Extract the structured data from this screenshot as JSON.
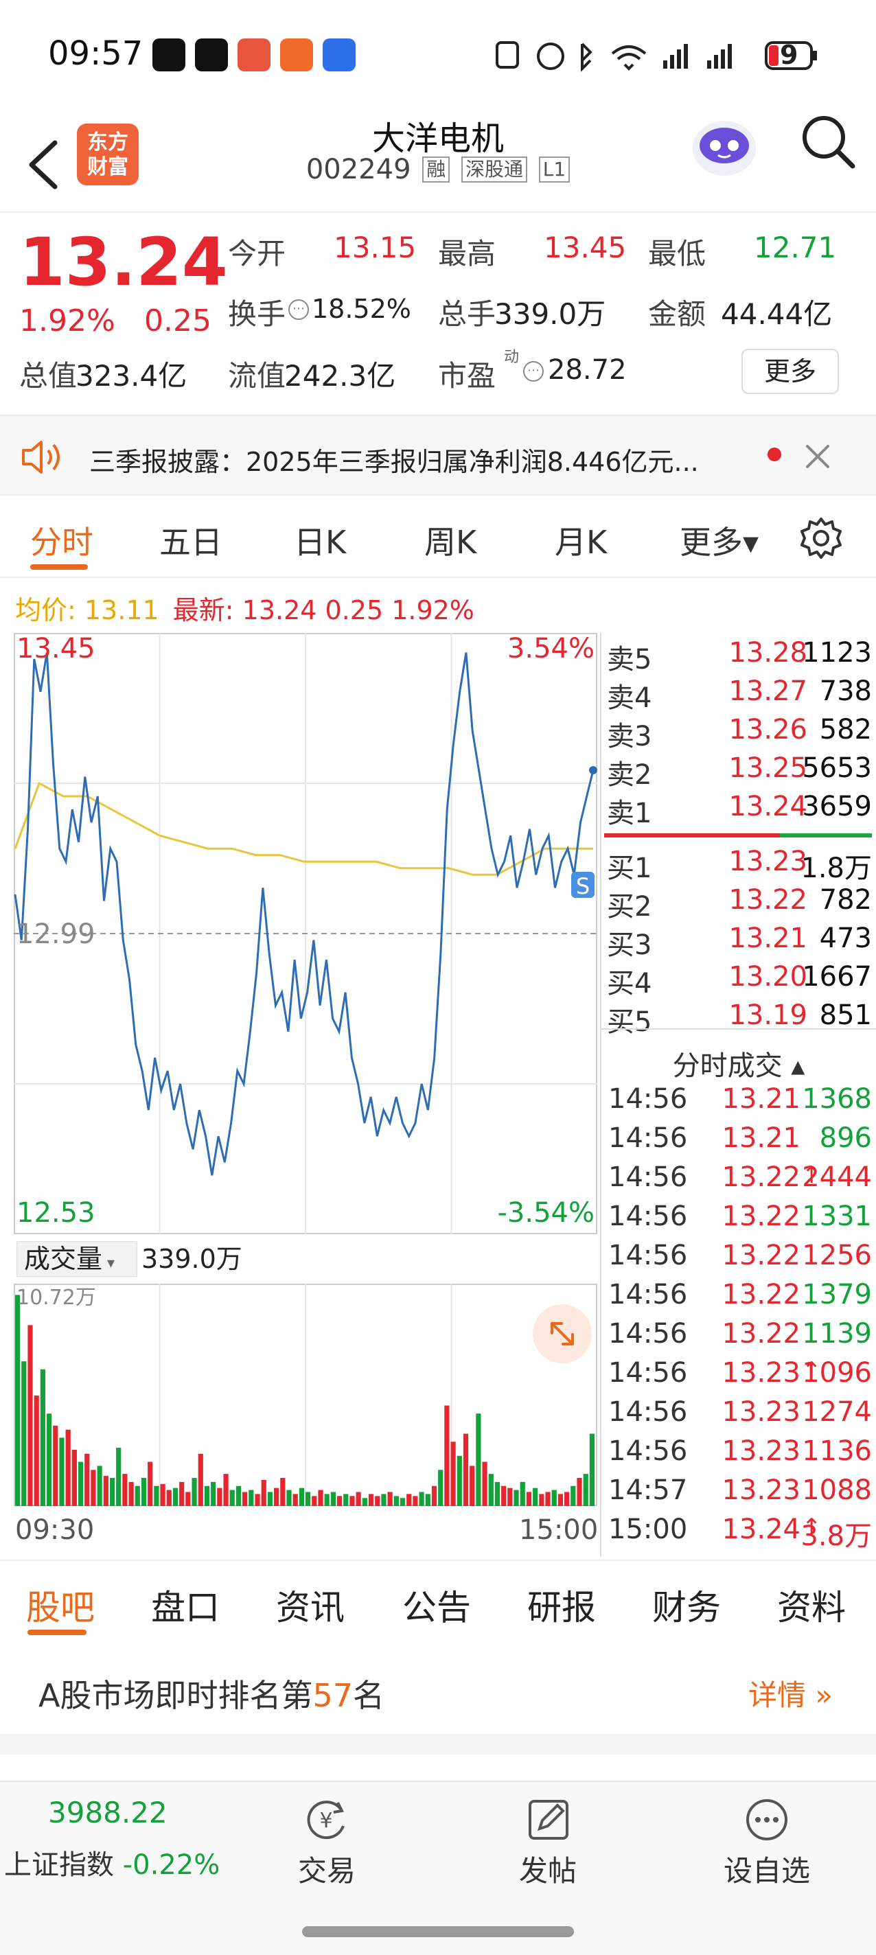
{
  "status": {
    "time": "09:57",
    "battery": "9"
  },
  "header": {
    "stock_name": "大洋电机",
    "stock_code": "002249",
    "tags": [
      "融",
      "深股通",
      "L1"
    ],
    "logo_line1": "东方",
    "logo_line2": "财富"
  },
  "quote": {
    "price": "13.24",
    "change_pct": "1.92%",
    "change_val": "0.25",
    "open_label": "今开",
    "open": "13.15",
    "high_label": "最高",
    "high": "13.45",
    "low_label": "最低",
    "low": "12.71",
    "turnover_label": "换手",
    "turnover": "18.52%",
    "vol_label": "总手",
    "vol": "339.0万",
    "amount_label": "金额",
    "amount": "44.44亿",
    "mktcap_label": "总值",
    "mktcap": "323.4亿",
    "float_label": "流值",
    "float": "242.3亿",
    "pe_label": "市盈",
    "pe_sup": "动",
    "pe": "28.72",
    "more": "更多"
  },
  "notice": {
    "text": "三季报披露：2025年三季报归属净利润8.446亿元..."
  },
  "chart_tabs": [
    "分时",
    "五日",
    "日K",
    "周K",
    "月K",
    "更多▾"
  ],
  "info_line": {
    "avg_label": "均价: 13.11",
    "latest_label": "最新: 13.24 0.25 1.92%"
  },
  "chart_labels": {
    "top_price": "13.45",
    "top_pct": "3.54%",
    "mid_price": "12.99",
    "bottom_price": "12.53",
    "bottom_pct": "-3.54%",
    "volume_label": "成交量",
    "volume_total": "339.0万",
    "volume_max": "10.72万",
    "time_start": "09:30",
    "time_end": "15:00",
    "marker": "S"
  },
  "chart_data": {
    "type": "line",
    "ylim": [
      12.53,
      13.45
    ],
    "ref_price": 12.99,
    "series": [
      {
        "values": [
          13.05,
          12.98,
          13.15,
          13.41,
          13.36,
          13.42,
          13.25,
          13.12,
          13.1,
          13.18,
          13.13,
          13.23,
          13.16,
          13.2,
          13.04,
          13.12,
          13.1,
          12.98,
          12.92,
          12.82,
          12.78,
          12.72,
          12.8,
          12.75,
          12.78,
          12.72,
          12.76,
          12.7,
          12.66,
          12.72,
          12.68,
          12.62,
          12.68,
          12.64,
          12.7,
          12.78,
          12.76,
          12.84,
          12.93,
          13.06,
          12.96,
          12.88,
          12.9,
          12.84,
          12.95,
          12.86,
          12.9,
          12.98,
          12.88,
          12.95,
          12.86,
          12.84,
          12.9,
          12.8,
          12.76,
          12.7,
          12.74,
          12.68,
          12.72,
          12.7,
          12.74,
          12.7,
          12.68,
          12.7,
          12.76,
          12.72,
          12.8,
          12.96,
          13.18,
          13.28,
          13.36,
          13.42,
          13.3,
          13.24,
          13.18,
          13.12,
          13.08,
          13.1,
          13.14,
          13.06,
          13.1,
          13.15,
          13.08,
          13.12,
          13.14,
          13.06,
          13.1,
          13.12,
          13.08,
          13.16,
          13.2,
          13.24
        ]
      },
      {
        "values": [
          13.12,
          13.22,
          13.2,
          13.2,
          13.18,
          13.16,
          13.14,
          13.13,
          13.12,
          13.12,
          13.11,
          13.11,
          13.1,
          13.1,
          13.1,
          13.1,
          13.09,
          13.09,
          13.09,
          13.08,
          13.08,
          13.1,
          13.12,
          13.12,
          13.12
        ]
      }
    ]
  },
  "volume_data": {
    "max": 10.72,
    "bars": [
      10.5,
      7.2,
      9.0,
      5.5,
      6.8,
      4.6,
      4.0,
      3.4,
      3.8,
      2.8,
      2.2,
      2.6,
      1.8,
      2.0,
      1.5,
      1.4,
      2.9,
      1.6,
      1.2,
      1.0,
      1.4,
      2.2,
      1.0,
      1.1,
      0.8,
      0.9,
      1.2,
      0.7,
      1.4,
      2.6,
      1.0,
      1.2,
      0.9,
      1.6,
      0.8,
      1.0,
      0.7,
      0.8,
      0.6,
      1.3,
      0.7,
      0.9,
      1.4,
      0.8,
      0.6,
      0.9,
      0.7,
      0.5,
      0.8,
      0.6,
      0.7,
      0.5,
      0.6,
      0.5,
      0.7,
      0.4,
      0.6,
      0.5,
      0.6,
      0.7,
      0.5,
      0.4,
      0.6,
      0.5,
      0.7,
      0.6,
      1.0,
      1.8,
      5.0,
      3.2,
      2.5,
      3.6,
      2.0,
      4.6,
      2.2,
      1.6,
      1.2,
      1.0,
      0.9,
      0.8,
      1.2,
      0.7,
      0.9,
      0.6,
      0.7,
      0.8,
      0.6,
      0.7,
      1.0,
      1.4,
      1.6,
      3.6
    ]
  },
  "orderbook": {
    "asks": [
      {
        "label": "卖5",
        "price": "13.28",
        "vol": "1123"
      },
      {
        "label": "卖4",
        "price": "13.27",
        "vol": "738"
      },
      {
        "label": "卖3",
        "price": "13.26",
        "vol": "582"
      },
      {
        "label": "卖2",
        "price": "13.25",
        "vol": "5653"
      },
      {
        "label": "卖1",
        "price": "13.24",
        "vol": "3659"
      }
    ],
    "bids": [
      {
        "label": "买1",
        "price": "13.23",
        "vol": "1.8万"
      },
      {
        "label": "买2",
        "price": "13.22",
        "vol": "782"
      },
      {
        "label": "买3",
        "price": "13.21",
        "vol": "473"
      },
      {
        "label": "买4",
        "price": "13.20",
        "vol": "1667"
      },
      {
        "label": "买5",
        "price": "13.19",
        "vol": "851"
      }
    ]
  },
  "ticks_header": "分时成交 ▴",
  "ticks": [
    {
      "time": "14:56",
      "price": "13.21",
      "arrow": "",
      "vol": "1368",
      "color": "#13a13a"
    },
    {
      "time": "14:56",
      "price": "13.21",
      "arrow": "",
      "vol": "896",
      "color": "#13a13a"
    },
    {
      "time": "14:56",
      "price": "13.22",
      "arrow": "↑",
      "vol": "2444",
      "color": "#e5262e"
    },
    {
      "time": "14:56",
      "price": "13.22",
      "arrow": "",
      "vol": "1331",
      "color": "#13a13a"
    },
    {
      "time": "14:56",
      "price": "13.22",
      "arrow": "",
      "vol": "1256",
      "color": "#e5262e"
    },
    {
      "time": "14:56",
      "price": "13.22",
      "arrow": "",
      "vol": "1379",
      "color": "#13a13a"
    },
    {
      "time": "14:56",
      "price": "13.22",
      "arrow": "",
      "vol": "1139",
      "color": "#13a13a"
    },
    {
      "time": "14:56",
      "price": "13.23",
      "arrow": "↑",
      "vol": "1096",
      "color": "#e5262e"
    },
    {
      "time": "14:56",
      "price": "13.23",
      "arrow": "",
      "vol": "1274",
      "color": "#e5262e"
    },
    {
      "time": "14:56",
      "price": "13.23",
      "arrow": "",
      "vol": "1136",
      "color": "#e5262e"
    },
    {
      "time": "14:57",
      "price": "13.23",
      "arrow": "",
      "vol": "1088",
      "color": "#e5262e"
    },
    {
      "time": "15:00",
      "price": "13.24",
      "arrow": "↑",
      "vol": "3.8万",
      "color": "#e5262e"
    }
  ],
  "bottom_tabs": [
    "股吧",
    "盘口",
    "资讯",
    "公告",
    "研报",
    "财务",
    "资料"
  ],
  "rank": {
    "prefix": "A股市场即时排名第",
    "number": "57",
    "suffix": "名",
    "detail": "详情 »"
  },
  "nav": {
    "index_value": "3988.22",
    "index_name": "上证指数",
    "index_change": "-0.22%",
    "trade": "交易",
    "post": "发帖",
    "watchlist": "设自选"
  },
  "colors": {
    "up": "#e5262e",
    "down": "#13a13a",
    "accent": "#e86a1a",
    "price_line": "#2e6db4",
    "avg_line": "#e8c53a"
  }
}
